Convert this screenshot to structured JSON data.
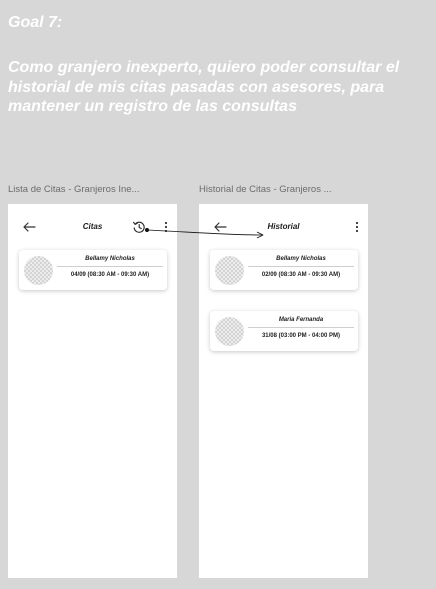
{
  "goal": {
    "title": "Goal 7:",
    "text": "Como granjero inexperto, quiero poder consultar el historial de mis citas pasadas con asesores, para mantener un registro de las consultas"
  },
  "frames": [
    {
      "label": "Lista de Citas - Granjeros Ine...",
      "appbar": {
        "title": "Citas"
      },
      "cards": [
        {
          "name": "Bellamy Nicholas",
          "time": "04/09 (08:30 AM - 09:30 AM)"
        }
      ]
    },
    {
      "label": "Historial de Citas - Granjeros ...",
      "appbar": {
        "title": "Historial"
      },
      "cards": [
        {
          "name": "Bellamy Nicholas",
          "time": "02/09 (08:30 AM - 09:30 AM)"
        },
        {
          "name": "Maria Fernanda",
          "time": "31/08 (03:00 PM - 04:00 PM)"
        }
      ]
    }
  ],
  "colors": {
    "canvas": "#d7d7d7",
    "screen": "#ffffff",
    "text": "#222222"
  },
  "icons": {
    "back": "arrow-left-icon",
    "history": "history-icon",
    "menu": "kebab-menu-icon"
  }
}
